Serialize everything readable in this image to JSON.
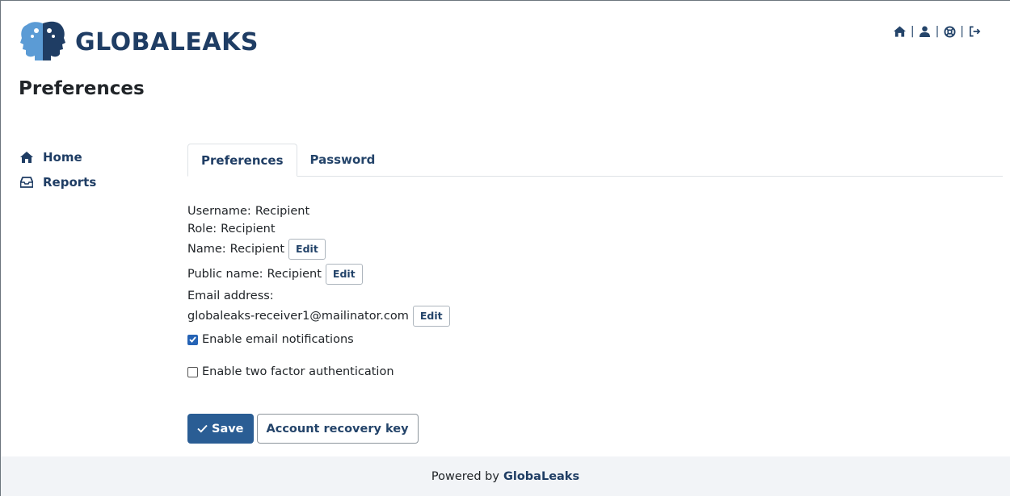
{
  "header": {
    "logo_text": "GLOBALEAKS",
    "icons": [
      "home-icon",
      "user-icon",
      "support-icon",
      "logout-icon"
    ],
    "separator": "|"
  },
  "page_title": "Preferences",
  "sidebar": {
    "items": [
      {
        "label": "Home",
        "icon": "home-icon"
      },
      {
        "label": "Reports",
        "icon": "inbox-icon"
      }
    ]
  },
  "tabs": [
    {
      "label": "Preferences",
      "active": true
    },
    {
      "label": "Password",
      "active": false
    }
  ],
  "profile": {
    "username_label": "Username:",
    "username_value": "Recipient",
    "role_label": "Role:",
    "role_value": "Recipient",
    "name_label": "Name:",
    "name_value": "Recipient",
    "public_name_label": "Public name:",
    "public_name_value": "Recipient",
    "email_label": "Email address:",
    "email_value": "globaleaks-receiver1@mailinator.com",
    "edit_label": "Edit"
  },
  "options": {
    "email_notifications_label": "Enable email notifications",
    "email_notifications_checked": true,
    "two_factor_label": "Enable two factor authentication",
    "two_factor_checked": false
  },
  "actions": {
    "save_label": "Save",
    "recovery_key_label": "Account recovery key"
  },
  "footer": {
    "prefix": "Powered by",
    "brand": "GlobaLeaks"
  },
  "colors": {
    "brand": "#1f3d64",
    "primary_button": "#2a5d94",
    "checkbox": "#2563b5",
    "footer_bg": "#f2f4f7"
  }
}
